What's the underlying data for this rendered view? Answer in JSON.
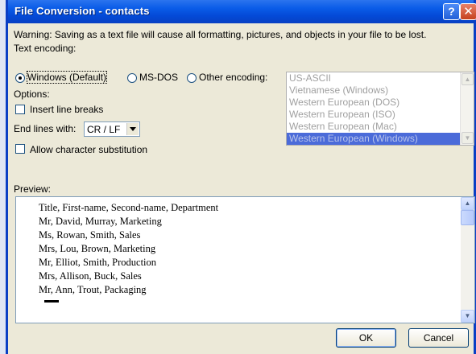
{
  "window": {
    "title": "File Conversion - contacts",
    "help_label": "?",
    "close_label": "✕"
  },
  "warning_text": "Warning: Saving as a text file will cause all formatting, pictures, and objects in your file to be lost.",
  "text_encoding": {
    "label": "Text encoding:",
    "options": [
      {
        "label": "Windows (Default)",
        "selected": true
      },
      {
        "label": "MS-DOS",
        "selected": false
      },
      {
        "label": "Other encoding:",
        "selected": false
      }
    ],
    "encoding_list": [
      "US-ASCII",
      "Vietnamese (Windows)",
      "Western European (DOS)",
      "Western European (ISO)",
      "Western European (Mac)",
      "Western European (Windows)"
    ],
    "selected_encoding": "Western European (Windows)"
  },
  "options": {
    "label": "Options:",
    "insert_line_breaks": {
      "label": "Insert line breaks",
      "checked": false
    },
    "end_lines_label": "End lines with:",
    "end_lines_value": "CR / LF",
    "allow_substitution": {
      "label": "Allow character substitution",
      "checked": false
    }
  },
  "preview": {
    "label": "Preview:",
    "lines": [
      "Title, First-name, Second-name, Department",
      "Mr, David, Murray, Marketing",
      "Ms, Rowan, Smith, Sales",
      "Mrs, Lou, Brown, Marketing",
      "Mr, Elliot, Smith, Production",
      "Mrs, Allison, Buck, Sales",
      "Mr, Ann, Trout, Packaging"
    ]
  },
  "buttons": {
    "ok": "OK",
    "cancel": "Cancel"
  }
}
